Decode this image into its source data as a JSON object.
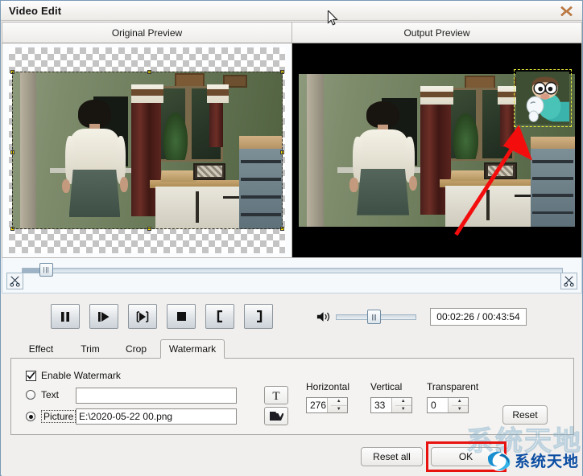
{
  "window": {
    "title": "Video Edit",
    "close_icon": "close-x-icon"
  },
  "preview": {
    "original_label": "Original Preview",
    "output_label": "Output Preview"
  },
  "timeline": {
    "trim_start_icon": "scissors-icon",
    "trim_end_icon": "scissors-icon",
    "position_percent": 4
  },
  "transport": {
    "buttons": [
      {
        "name": "pause-button",
        "icon": "pause-icon"
      },
      {
        "name": "play-frame-button",
        "icon": "play-bar-icon"
      },
      {
        "name": "next-frame-button",
        "icon": "step-forward-icon"
      },
      {
        "name": "stop-button",
        "icon": "stop-icon"
      },
      {
        "name": "mark-in-button",
        "icon": "bracket-left-icon"
      },
      {
        "name": "mark-out-button",
        "icon": "bracket-right-icon"
      }
    ],
    "volume_icon": "speaker-icon",
    "volume_percent": 40,
    "time_display": "00:02:26 / 00:43:54"
  },
  "tabs": [
    {
      "label": "Effect",
      "active": false
    },
    {
      "label": "Trim",
      "active": false
    },
    {
      "label": "Crop",
      "active": false
    },
    {
      "label": "Watermark",
      "active": true
    }
  ],
  "watermark_panel": {
    "enable_label": "Enable Watermark",
    "enable_checked": true,
    "text_label": "Text",
    "text_selected": false,
    "text_value": "",
    "text_placeholder": "",
    "text_button_icon": "font-T-icon",
    "picture_label": "Picture",
    "picture_selected": true,
    "picture_value": "E:\\2020-05-22 00.png",
    "picture_button_icon": "folder-open-icon",
    "horizontal_label": "Horizontal",
    "horizontal_value": "276",
    "vertical_label": "Vertical",
    "vertical_value": "33",
    "transparent_label": "Transparent",
    "transparent_value": "0",
    "reset_label": "Reset"
  },
  "footer": {
    "reset_all_label": "Reset all",
    "ok_label": "OK",
    "highlight_color": "#e8120f"
  },
  "branding": {
    "logo_icon": "swoosh-logo-icon",
    "name": "系统天地",
    "ghost_text": "系统天地"
  },
  "colors": {
    "accent_highlight": "#e8120f",
    "selection_dash": "#ffe400",
    "brand_blue": "#0b4da2",
    "close_x": "#c07a3f"
  },
  "cursor": {
    "icon": "mouse-pointer-icon"
  }
}
